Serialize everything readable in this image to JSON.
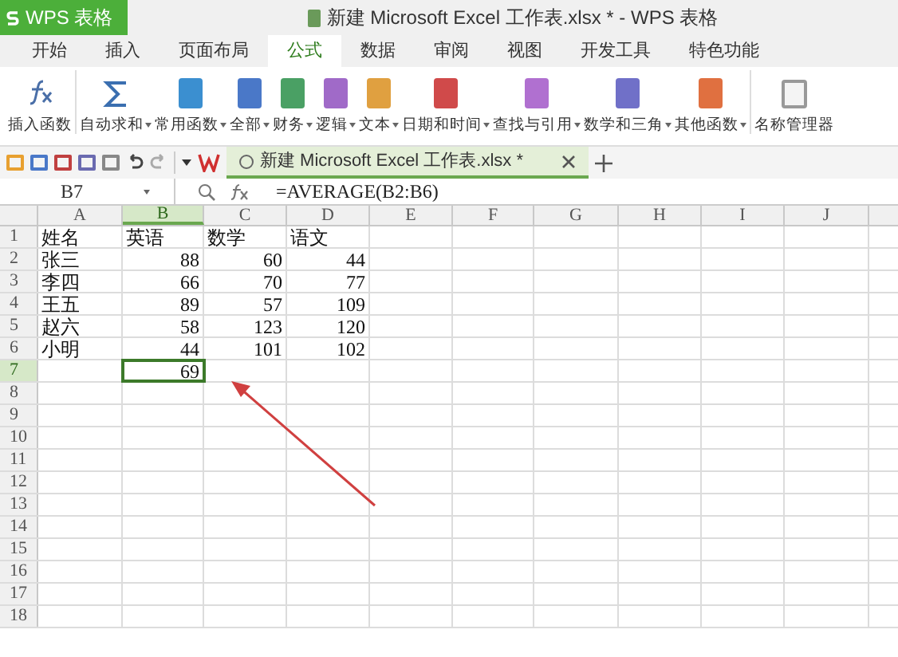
{
  "title_bar": {
    "app_menu": "WPS 表格",
    "title": "新建 Microsoft Excel 工作表.xlsx * - WPS 表格"
  },
  "tabs": [
    {
      "label": "开始",
      "selected": false
    },
    {
      "label": "插入",
      "selected": false
    },
    {
      "label": "页面布局",
      "selected": false
    },
    {
      "label": "公式",
      "selected": true
    },
    {
      "label": "数据",
      "selected": false
    },
    {
      "label": "审阅",
      "selected": false
    },
    {
      "label": "视图",
      "selected": false
    },
    {
      "label": "开发工具",
      "selected": false
    },
    {
      "label": "特色功能",
      "selected": false
    }
  ],
  "ribbon": [
    {
      "label": "插入函数",
      "kind": "fx",
      "dropdown": false
    },
    {
      "label": "自动求和",
      "kind": "sigma",
      "dropdown": true
    },
    {
      "label": "常用函数",
      "kind": "book",
      "color": "#3b8fd0",
      "dropdown": true
    },
    {
      "label": "全部",
      "kind": "book",
      "color": "#4a78c8",
      "dropdown": true
    },
    {
      "label": "财务",
      "kind": "book",
      "color": "#4aa064",
      "dropdown": true
    },
    {
      "label": "逻辑",
      "kind": "book",
      "color": "#a06ac8",
      "dropdown": true
    },
    {
      "label": "文本",
      "kind": "book",
      "color": "#e0a040",
      "dropdown": true
    },
    {
      "label": "日期和时间",
      "kind": "book",
      "color": "#d04a4a",
      "dropdown": true
    },
    {
      "label": "查找与引用",
      "kind": "book",
      "color": "#b070d0",
      "dropdown": true
    },
    {
      "label": "数学和三角",
      "kind": "book",
      "color": "#7070c8",
      "dropdown": true
    },
    {
      "label": "其他函数",
      "kind": "book",
      "color": "#e07040",
      "dropdown": true
    },
    {
      "label": "名称管理器",
      "kind": "names",
      "dropdown": false
    }
  ],
  "document_tab": {
    "title": "新建 Microsoft Excel 工作表.xlsx *"
  },
  "formula_bar": {
    "name_box": "B7",
    "formula": "=AVERAGE(B2:B6)"
  },
  "grid": {
    "columns": [
      {
        "label": "A",
        "selected": false
      },
      {
        "label": "B",
        "selected": true
      },
      {
        "label": "C",
        "selected": false
      },
      {
        "label": "D",
        "selected": false
      },
      {
        "label": "E",
        "selected": false
      },
      {
        "label": "F",
        "selected": false
      },
      {
        "label": "G",
        "selected": false
      },
      {
        "label": "H",
        "selected": false
      },
      {
        "label": "I",
        "selected": false
      },
      {
        "label": "J",
        "selected": false
      }
    ],
    "rows": [
      {
        "label": "1",
        "selected": false,
        "cells": [
          "姓名",
          "英语",
          "数学",
          "语文"
        ]
      },
      {
        "label": "2",
        "selected": false,
        "cells": [
          "张三",
          "88",
          "60",
          "44"
        ]
      },
      {
        "label": "3",
        "selected": false,
        "cells": [
          "李四",
          "66",
          "70",
          "77"
        ]
      },
      {
        "label": "4",
        "selected": false,
        "cells": [
          "王五",
          "89",
          "57",
          "109"
        ]
      },
      {
        "label": "5",
        "selected": false,
        "cells": [
          "赵六",
          "58",
          "123",
          "120"
        ]
      },
      {
        "label": "6",
        "selected": false,
        "cells": [
          "小明",
          "44",
          "101",
          "102"
        ]
      },
      {
        "label": "7",
        "selected": true,
        "cells": [
          null,
          "69"
        ]
      },
      {
        "label": "8",
        "selected": false
      },
      {
        "label": "9",
        "selected": false
      },
      {
        "label": "10",
        "selected": false
      },
      {
        "label": "11",
        "selected": false
      },
      {
        "label": "12",
        "selected": false
      },
      {
        "label": "13",
        "selected": false
      },
      {
        "label": "14",
        "selected": false
      },
      {
        "label": "15",
        "selected": false
      },
      {
        "label": "16",
        "selected": false
      },
      {
        "label": "17",
        "selected": false
      },
      {
        "label": "18",
        "selected": false
      }
    ]
  }
}
